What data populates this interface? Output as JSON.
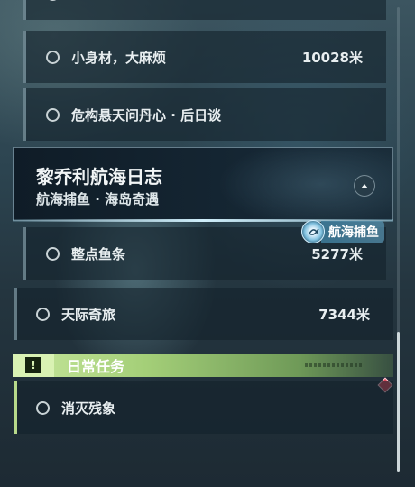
{
  "quest_rows": [
    {
      "label": "小身材，大麻烦",
      "distance": "10028米"
    },
    {
      "label": "危构悬天问丹心 · 后日谈",
      "distance": ""
    }
  ],
  "chapter": {
    "title": "黎乔利航海日志",
    "subtitle": "航海捕鱼 · 海岛奇遇",
    "badge_label": "航海捕鱼"
  },
  "chapter_rows": [
    {
      "label": "整点鱼条",
      "distance": "5277米"
    },
    {
      "label": "天际奇旅",
      "distance": "7344米"
    }
  ],
  "daily": {
    "title": "日常任务",
    "accent_color": "#b7d98a",
    "rows": [
      {
        "label": "消灭残象",
        "distance": ""
      }
    ]
  },
  "icons": {
    "quest_status": "hollow-circle-icon",
    "collapse": "chevron-up-icon",
    "daily": "exclamation-icon",
    "badge": "fishing-icon",
    "alert": "red-diamond-icon"
  }
}
